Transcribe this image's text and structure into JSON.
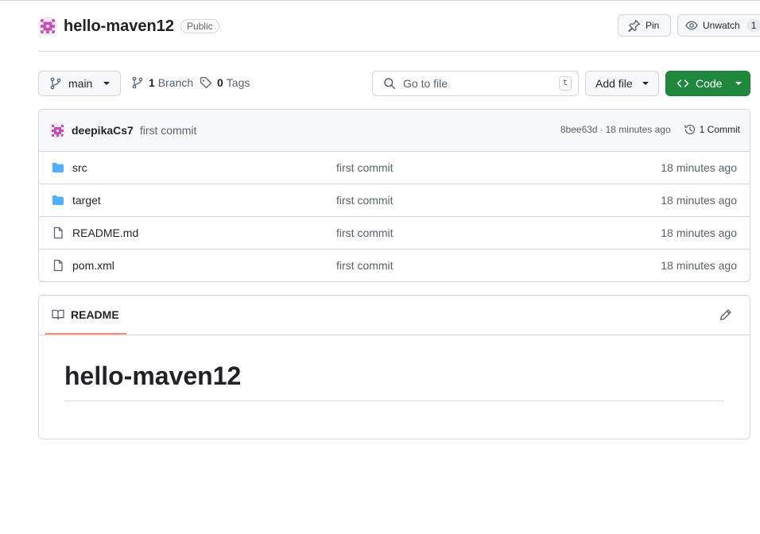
{
  "repo": {
    "name": "hello-maven12",
    "visibility": "Public"
  },
  "header_actions": {
    "pin_label": "Pin",
    "watch_label": "Unwatch",
    "watch_count": "1"
  },
  "toolbar": {
    "branch": "main",
    "branch_count": "1",
    "branch_label": "Branch",
    "tag_count": "0",
    "tag_label": "Tags",
    "search_placeholder": "Go to file",
    "search_shortcut": "t",
    "add_file_label": "Add file",
    "code_label": "Code"
  },
  "latest_commit": {
    "author": "deepikaCs7",
    "message": "first commit",
    "hash": "8bee63d",
    "separator": "·",
    "time": "18 minutes ago",
    "commits_label": "1 Commit"
  },
  "files": [
    {
      "name": "src",
      "type": "folder",
      "commit": "first commit",
      "time": "18 minutes ago"
    },
    {
      "name": "target",
      "type": "folder",
      "commit": "first commit",
      "time": "18 minutes ago"
    },
    {
      "name": "README.md",
      "type": "file",
      "commit": "first commit",
      "time": "18 minutes ago"
    },
    {
      "name": "pom.xml",
      "type": "file",
      "commit": "first commit",
      "time": "18 minutes ago"
    }
  ],
  "readme": {
    "tab_label": "README",
    "heading": "hello-maven12"
  },
  "colors": {
    "primary_button": "#1f883d",
    "folder_icon": "#54aeff",
    "tab_underline": "#fd8c73",
    "avatar": "#c14fb3"
  },
  "icons": {
    "pin": "pin-icon",
    "watch": "eye-icon",
    "branch": "git-branch-icon",
    "tag": "tag-icon",
    "search": "search-icon",
    "code": "code-icon",
    "history": "history-icon",
    "folder": "folder-icon",
    "file": "file-icon",
    "readme": "book-icon",
    "edit": "pencil-icon"
  }
}
